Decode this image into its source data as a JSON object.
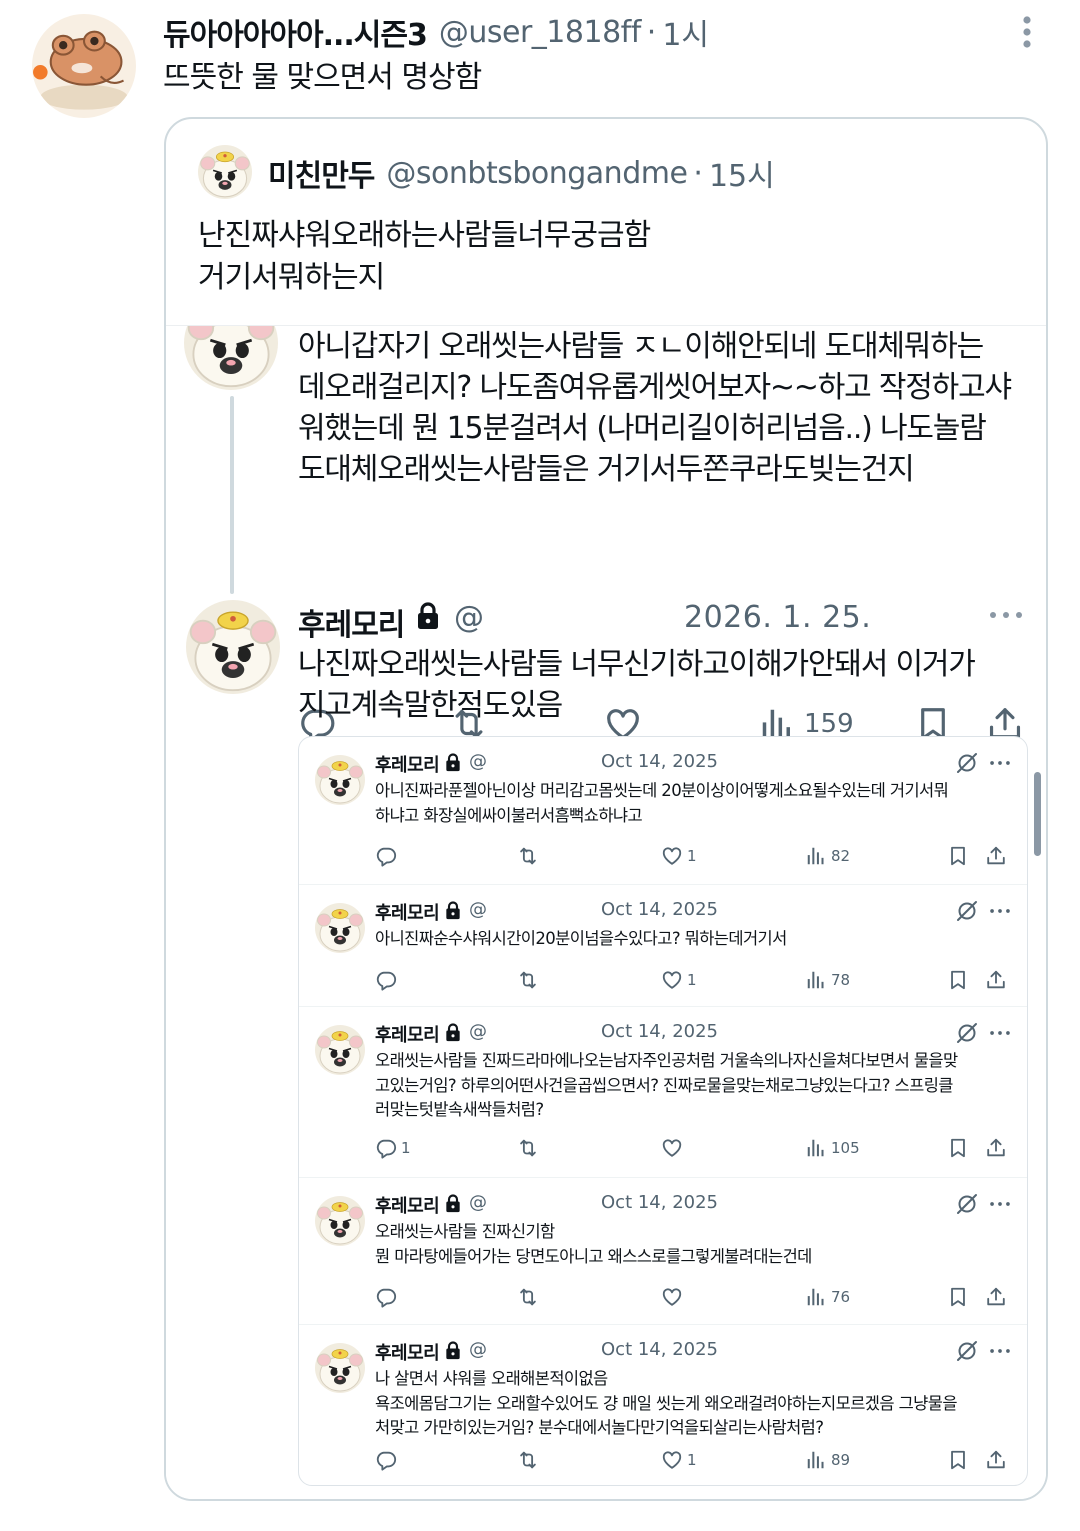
{
  "top_tweet": {
    "display_name": "듀아아아아아...시즌3",
    "handle": "@user_1818ff",
    "time": "1시",
    "text": "뜨뜻한 물 맞으면서 명상함"
  },
  "quoted_tweet": {
    "display_name": "미친만두",
    "handle": "@sonbtsbongandme",
    "time": "15시",
    "text_line1": "난진짜샤워오래하는사람들너무궁금함",
    "text_line2": "거기서뭐하는지"
  },
  "screenshot": {
    "post1": {
      "lines": [
        "아니갑자기 오래씻는사람들 ㅈㄴ이해안되네 도대체뭐하는",
        "데오래걸리지? 나도좀여유롭게씻어보자~~하고 작정하고샤",
        "워했는데 뭔 15분걸려서 (나머리길이허리넘음..) 나도놀람",
        "도대체오래씻는사람들은 거기서두쫀쿠라도빚는건지"
      ],
      "view_count": "159"
    },
    "post2": {
      "display_name": "후레모리",
      "handle": "@",
      "date": "2026. 1. 25.",
      "lines": [
        "나진짜오래씻는사람들 너무신기하고이해가안돼서 이거가",
        "지고계속말한적도있음"
      ]
    },
    "inner_posts": [
      {
        "display_name": "후레모리",
        "handle": "@",
        "date": "Oct 14, 2025",
        "lines": [
          "아니진짜라푼젤아닌이상 머리감고몸씻는데 20분이상이어떻게소요될수있는데 거기서뭐",
          "하냐고 화장실에싸이불러서흠뻑쇼하냐고"
        ],
        "replies": "",
        "likes": "1",
        "views": "82"
      },
      {
        "display_name": "후레모리",
        "handle": "@",
        "date": "Oct 14, 2025",
        "lines": [
          "아니진짜순수샤워시간이20분이넘을수있다고? 뭐하는데거기서"
        ],
        "replies": "",
        "likes": "1",
        "views": "78"
      },
      {
        "display_name": "후레모리",
        "handle": "@",
        "date": "Oct 14, 2025",
        "lines": [
          "오래씻는사람들 진짜드라마에나오는남자주인공처럼 거울속의나자신을쳐다보면서 물을맞",
          "고있는거임? 하루의어떤사건을곱씹으면서? 진짜로물을맞는채로그냥있는다고? 스프링클",
          "러맞는텃밭속새싹들처럼?"
        ],
        "replies": "1",
        "likes": "",
        "views": "105"
      },
      {
        "display_name": "후레모리",
        "handle": "@",
        "date": "Oct 14, 2025",
        "lines": [
          "오래씻는사람들 진짜신기함",
          "뭔 마라탕에들어가는 당면도아니고 왜스스로를그렇게불려대는건데"
        ],
        "replies": "",
        "likes": "",
        "views": "76"
      },
      {
        "display_name": "후레모리",
        "handle": "@",
        "date": "Oct 14, 2025",
        "lines": [
          "나 살면서 샤워를 오래해본적이없음",
          "욕조에몸담그기는 오래할수있어도 걍 매일 씻는게 왜오래걸려야하는지모르겠음 그냥물을",
          "처맞고 가만히있는거임? 분수대에서놀다만기억을되살리는사람처럼?"
        ],
        "replies": "",
        "likes": "1",
        "views": "89"
      }
    ]
  },
  "icons": {
    "reply": "reply-icon",
    "retweet": "retweet-icon",
    "like": "like-icon",
    "views": "views-icon",
    "bookmark": "bookmark-icon",
    "share": "share-icon",
    "lock": "lock-icon",
    "grok": "grok-icon",
    "more": "more-icon"
  },
  "colors": {
    "text_primary": "#0f1419",
    "text_secondary": "#536471",
    "border": "#cfd9de"
  }
}
